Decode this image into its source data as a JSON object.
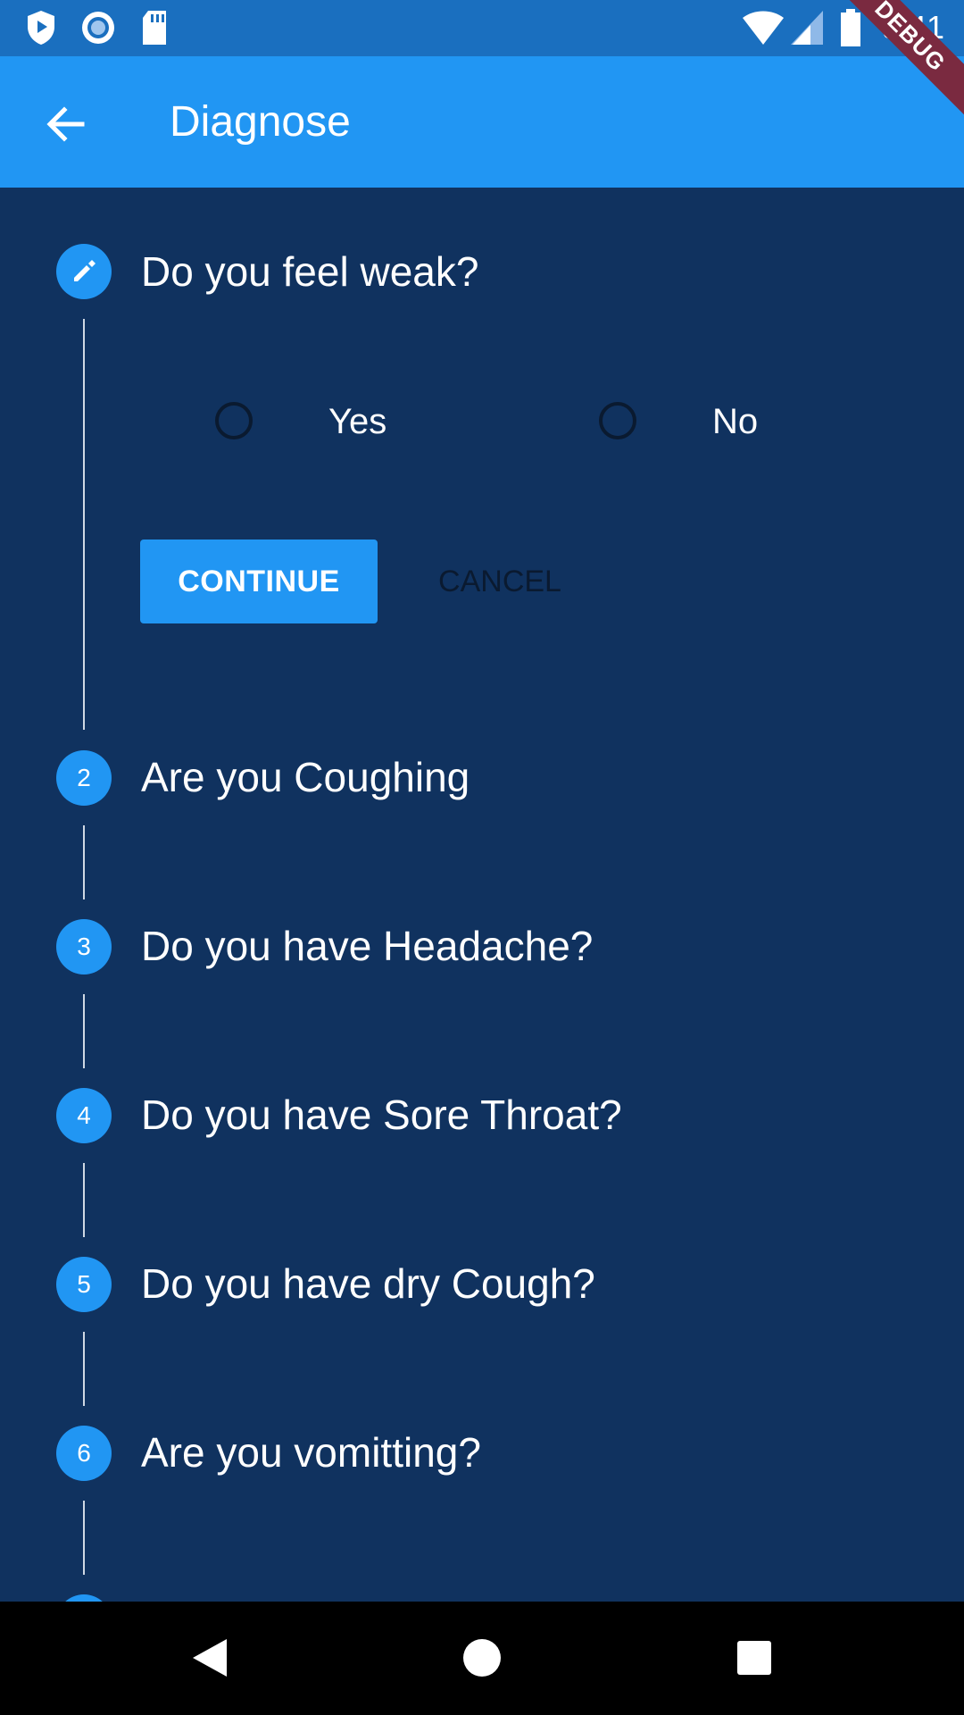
{
  "status_bar": {
    "time": "9:41",
    "icons_left": [
      "shield-play-icon",
      "record-icon",
      "sd-card-icon"
    ],
    "icons_right": [
      "wifi-icon",
      "signal-icon",
      "battery-icon"
    ]
  },
  "debug_banner": "DEBUG",
  "app_bar": {
    "title": "Diagnose",
    "back_icon": "arrow-back-icon"
  },
  "steps": [
    {
      "number": "",
      "icon": "edit-pencil-icon",
      "title": "Do you feel weak?",
      "active": true
    },
    {
      "number": "2",
      "title": "Are you Coughing"
    },
    {
      "number": "3",
      "title": "Do you have Headache?"
    },
    {
      "number": "4",
      "title": "Do you have Sore Throat?"
    },
    {
      "number": "5",
      "title": "Do you have dry Cough?"
    },
    {
      "number": "6",
      "title": "Are you vomitting?"
    }
  ],
  "active_step": {
    "options": [
      {
        "label": "Yes",
        "selected": false
      },
      {
        "label": "No",
        "selected": false
      }
    ],
    "continue_label": "CONTINUE",
    "cancel_label": "CANCEL"
  },
  "colors": {
    "background": "#10325f",
    "app_bar": "#2196f3",
    "status_bar": "#1a6fbf",
    "accent": "#2196f3"
  },
  "nav_bar": {
    "icons": [
      "back-triangle-icon",
      "home-circle-icon",
      "recents-square-icon"
    ]
  }
}
